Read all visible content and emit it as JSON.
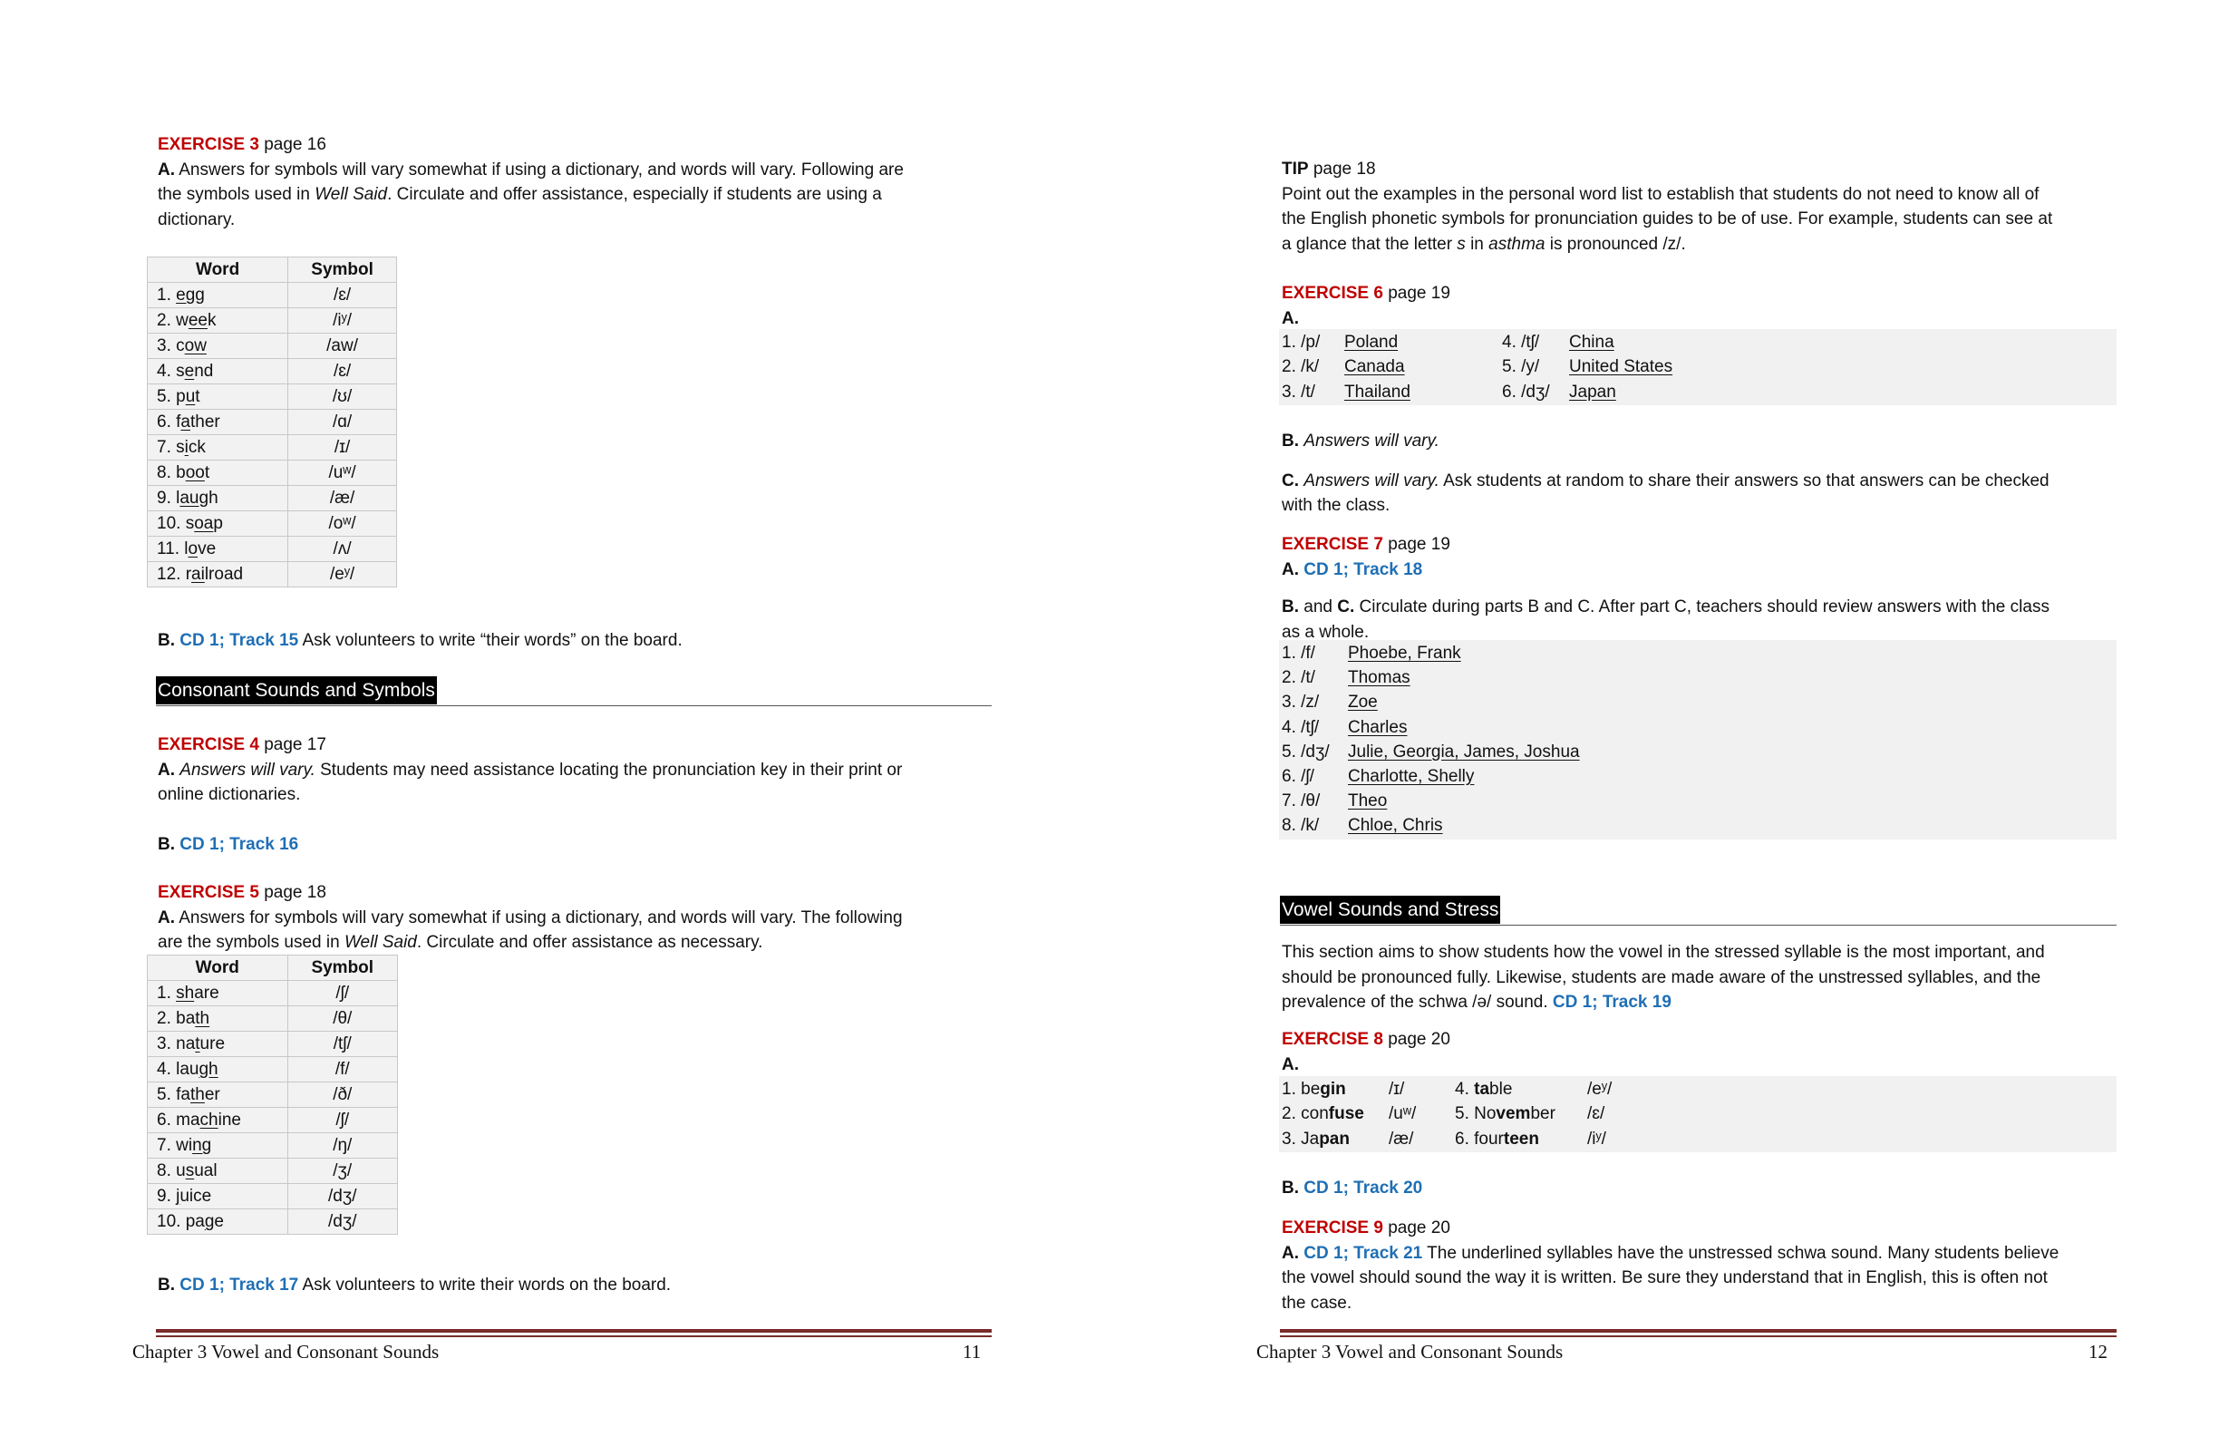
{
  "left": {
    "ex3": {
      "title": "EXERCISE 3",
      "page": "page 16",
      "a_label": "A.",
      "a_text_1": "Answers for symbols will vary somewhat if using a dictionary, and words will vary. Following are",
      "a_text_2a": "the symbols used in ",
      "a_text_2_italic": "Well Said",
      "a_text_2b": ". Circulate and offer assistance, especially if students are using a",
      "a_text_3": "dictionary."
    },
    "table1": {
      "headers": [
        "Word",
        "Symbol"
      ],
      "rows": [
        {
          "n": "1. ",
          "pre": "",
          "u": "egg",
          "post": "",
          "sym": "/ɛ/"
        },
        {
          "n": "2. ",
          "pre": "w",
          "u": "ee",
          "post": "k",
          "sym": "/iʸ/"
        },
        {
          "n": "3. ",
          "pre": "c",
          "u": "ow",
          "post": "",
          "sym": "/aw/"
        },
        {
          "n": "4. ",
          "pre": "s",
          "u": "e",
          "post": "nd",
          "sym": "/ɛ/"
        },
        {
          "n": "5. ",
          "pre": "p",
          "u": "u",
          "post": "t",
          "sym": "/ʊ/"
        },
        {
          "n": "6. ",
          "pre": "f",
          "u": "a",
          "post": "ther",
          "sym": "/ɑ/"
        },
        {
          "n": "7. ",
          "pre": "s",
          "u": "i",
          "post": "ck",
          "sym": "/ɪ/"
        },
        {
          "n": "8. ",
          "pre": "b",
          "u": "oo",
          "post": "t",
          "sym": "/uʷ/"
        },
        {
          "n": "9. ",
          "pre": "l",
          "u": "au",
          "post": "gh",
          "sym": "/æ/"
        },
        {
          "n": "10. ",
          "pre": "s",
          "u": "oa",
          "post": "p",
          "sym": "/oʷ/"
        },
        {
          "n": "11. ",
          "pre": "l",
          "u": "o",
          "post": "ve",
          "sym": "/ʌ/"
        },
        {
          "n": "12. ",
          "pre": "r",
          "u": "ai",
          "post": "lroad",
          "sym": "/eʸ/"
        }
      ]
    },
    "b1": {
      "label": "B.",
      "cd": "CD 1; Track 15",
      "text": " Ask volunteers to write “their words” on the board."
    },
    "section_consonant": "Consonant Sounds and Symbols",
    "ex4": {
      "title": "EXERCISE 4",
      "page": "page 17",
      "a_label": "A.",
      "a_italic": "Answers will vary.",
      "a_text_1": " Students may need assistance locating the pronunciation key in their print or",
      "a_text_2": "online dictionaries.",
      "b_label": "B.",
      "b_cd": "CD 1; Track 16"
    },
    "ex5": {
      "title": "EXERCISE 5",
      "page": "page 18",
      "a_label": "A.",
      "a_text_1": "Answers for symbols will vary somewhat if using a dictionary, and words will vary. The following",
      "a_text_2a": "are the symbols used in ",
      "a_text_2_italic": "Well Said",
      "a_text_2b": ". Circulate and offer assistance as necessary."
    },
    "table2": {
      "headers": [
        "Word",
        "Symbol"
      ],
      "rows": [
        {
          "n": "1. ",
          "pre": "",
          "u": "sh",
          "post": "are",
          "sym": "/ʃ/"
        },
        {
          "n": "2. ",
          "pre": "ba",
          "u": "th",
          "post": "",
          "sym": "/θ/"
        },
        {
          "n": "3. ",
          "pre": "na",
          "u": "t",
          "post": "ure",
          "sym": "/tʃ/"
        },
        {
          "n": "4. ",
          "pre": "lau",
          "u": "gh",
          "post": "",
          "sym": "/f/"
        },
        {
          "n": "5. ",
          "pre": "fa",
          "u": "th",
          "post": "er",
          "sym": "/ð/"
        },
        {
          "n": "6. ",
          "pre": "ma",
          "u": "ch",
          "post": "ine",
          "sym": "/ʃ/"
        },
        {
          "n": "7. ",
          "pre": "wi",
          "u": "ng",
          "post": "",
          "sym": "/ŋ/"
        },
        {
          "n": "8. ",
          "pre": "u",
          "u": "s",
          "post": "ual",
          "sym": "/ʒ/"
        },
        {
          "n": "9. ",
          "pre": "",
          "u": "j",
          "post": "uice",
          "sym": "/dʒ/"
        },
        {
          "n": "10. ",
          "pre": "pa",
          "u": "g",
          "post": "e",
          "sym": "/dʒ/"
        }
      ]
    },
    "b3": {
      "label": "B.",
      "cd": "CD 1; Track 17",
      "text": " Ask volunteers to write their words on the board."
    },
    "footer": {
      "chapter": "Chapter 3 Vowel and Consonant Sounds",
      "number": "11"
    }
  },
  "right": {
    "tip": {
      "title": "TIP",
      "page": "page 18",
      "line1": "Point out the examples in the personal word list to establish that students do not need to know all of",
      "line2": "the English phonetic symbols for pronunciation guides to be of use. For example, students can see at",
      "line3a": "a glance that the letter ",
      "line3_s": "s",
      "line3b": " in ",
      "line3_asthma": "asthma",
      "line3c": " is pronounced /z/."
    },
    "ex6": {
      "title": "EXERCISE 6",
      "page": "page 19",
      "a_label": "A.",
      "items": [
        {
          "n": "1. /p/",
          "w": "Poland"
        },
        {
          "n": "2. /k/",
          "w": "Canada"
        },
        {
          "n": "3. /t/",
          "w": "Thailand"
        },
        {
          "n": "4. /tʃ/",
          "w": "China"
        },
        {
          "n": "5. /y/",
          "w": "United States"
        },
        {
          "n": "6. /dʒ/",
          "w": "Japan"
        }
      ],
      "b_label": "B.",
      "b_italic": "Answers will vary.",
      "c_label": "C.",
      "c_italic": "Answers will vary.",
      "c_text_1": " Ask students at random to share their answers so that answers can be checked",
      "c_text_2": "with the class."
    },
    "ex7": {
      "title": "EXERCISE 7",
      "page": "page 19",
      "a_label": "A.",
      "a_cd": "CD 1; Track 18",
      "b_label": "B.",
      "b_and": " and ",
      "c_label": "C.",
      "bc_text_1": " Circulate during parts B and C. After part C, teachers should review answers with the class",
      "bc_text_2": "as a whole.",
      "items": [
        {
          "n": "1. /f/",
          "w": "Phoebe, Frank"
        },
        {
          "n": "2. /t/",
          "w": "Thomas"
        },
        {
          "n": "3. /z/",
          "w": "Zoe"
        },
        {
          "n": "4. /tʃ/",
          "w": "Charles"
        },
        {
          "n": "5. /dʒ/",
          "w": "Julie, Georgia, James, Joshua"
        },
        {
          "n": "6. /ʃ/",
          "w": "Charlotte, Shelly"
        },
        {
          "n": "7. /θ/",
          "w": "Theo"
        },
        {
          "n": "8. /k/",
          "w": "Chloe, Chris"
        }
      ]
    },
    "section_vowel": "Vowel Sounds and Stress",
    "vowel_intro": {
      "line1": "This section aims to show students how the vowel in the stressed syllable is the most important, and",
      "line2": "should be pronounced fully. Likewise, students are made aware of the unstressed syllables, and the",
      "line3": "prevalence of the schwa /ə/ sound. ",
      "cd": "CD 1; Track 19"
    },
    "ex8": {
      "title": "EXERCISE 8",
      "page": "page 20",
      "a_label": "A.",
      "items": [
        {
          "n": "1. ",
          "pre": "be",
          "stress": "gin",
          "post": "",
          "sym": "/ɪ/"
        },
        {
          "n": "2. ",
          "pre": "con",
          "stress": "fuse",
          "post": "",
          "sym": "/uʷ/"
        },
        {
          "n": "3. ",
          "pre": "Ja",
          "stress": "pan",
          "post": "",
          "sym": "/æ/"
        },
        {
          "n": "4. ",
          "pre": "",
          "stress": "ta",
          "post": "ble",
          "sym": "/eʸ/"
        },
        {
          "n": "5. ",
          "pre": "No",
          "stress": "vem",
          "post": "ber",
          "sym": "/ɛ/"
        },
        {
          "n": "6. ",
          "pre": "four",
          "stress": "teen",
          "post": "",
          "sym": "/iʸ/"
        }
      ],
      "b_label": "B.",
      "b_cd": "CD 1; Track 20"
    },
    "ex9": {
      "title": "EXERCISE 9",
      "page": "page 20",
      "a_label": "A.",
      "a_cd": "CD 1; Track 21",
      "a_text_1": " The underlined syllables have the unstressed schwa sound. Many students believe",
      "a_text_2": "the vowel should sound the way it is written. Be sure they understand that in English, this is often not",
      "a_text_3": "the case."
    },
    "footer": {
      "chapter": "Chapter 3 Vowel and Consonant Sounds",
      "number": "12"
    }
  }
}
